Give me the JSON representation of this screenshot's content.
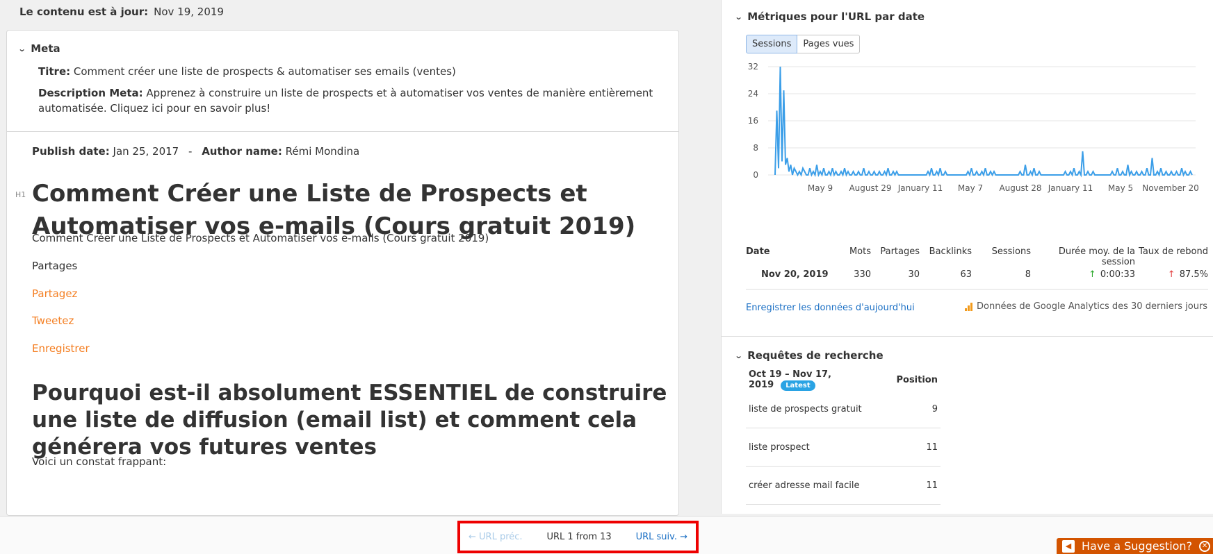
{
  "header": {
    "uptodate_label": "Le contenu est à jour:",
    "uptodate_date": "Nov 19, 2019"
  },
  "meta": {
    "title": "Meta",
    "titre_label": "Titre:",
    "titre_value": "Comment créer une liste de prospects & automatiser ses emails (ventes)",
    "desc_label": "Description Meta:",
    "desc_value": "Apprenez à construire un liste de prospects et à automatiser vos ventes de manière entièrement automatisée. Cliquez ici pour en savoir plus!"
  },
  "article": {
    "publish_label": "Publish date:",
    "publish_value": "Jan 25, 2017",
    "separator": "-",
    "author_label": "Author name:",
    "author_value": "Rémi Mondina",
    "h1_tag": "H1",
    "h1": "Comment Créer une Liste de Prospects et Automatiser vos e-mails (Cours gratuit 2019)",
    "p1": "Comment Créer une Liste de Prospects et Automatiser vos e-mails (Cours gratuit 2019)",
    "p2": "Partages",
    "links": [
      "Partagez",
      "Tweetez",
      "Enregistrer"
    ],
    "h2": "Pourquoi est-il absolument ESSENTIEL de construire une liste de diffusion (email list) et comment cela générera vos futures ventes",
    "p3": "Voici un constat frappant:"
  },
  "metrics": {
    "title": "Métriques pour l'URL par date",
    "tabs": [
      "Sessions",
      "Pages vues"
    ],
    "active_tab": "Sessions",
    "table": {
      "headers": [
        "Date",
        "Mots",
        "Partages",
        "Backlinks",
        "Sessions",
        "Durée moy. de la session",
        "Taux de rebond"
      ],
      "row": {
        "date": "Nov 20, 2019",
        "mots": "330",
        "partages": "30",
        "backlinks": "63",
        "sessions": "8",
        "duree": "0:00:33",
        "rebond": "87.5%"
      },
      "up_arrow": "↑"
    },
    "save_link": "Enregistrer les données d'aujourd'hui",
    "ga_note": "Données de Google Analytics des 30 derniers jours"
  },
  "chart_data": {
    "type": "line",
    "ylim": [
      0,
      32
    ],
    "yticks": [
      "0",
      "8",
      "16",
      "24",
      "32"
    ],
    "xticks": [
      "May 9",
      "August 29",
      "January 11",
      "May 7",
      "August 28",
      "January 11",
      "May 5",
      "November 20"
    ],
    "series": [
      {
        "values": [
          0,
          19,
          2,
          32,
          4,
          25,
          3,
          5,
          1,
          3,
          0,
          2,
          1,
          0,
          1,
          0,
          2,
          1,
          0,
          0,
          2,
          0,
          1,
          0,
          3,
          0,
          1,
          0,
          2,
          0,
          0,
          1,
          0,
          2,
          0,
          1,
          0,
          0,
          1,
          0,
          2,
          0,
          1,
          0,
          0,
          1,
          0,
          0,
          1,
          0,
          0,
          2,
          0,
          0,
          1,
          0,
          0,
          1,
          0,
          0,
          1,
          0,
          0,
          1,
          0,
          2,
          0,
          0,
          1,
          0,
          1,
          0,
          0,
          0,
          0,
          0,
          0,
          0,
          0,
          0,
          0,
          0,
          0,
          0,
          0,
          0,
          0,
          0,
          1,
          0,
          2,
          0,
          0,
          1,
          0,
          2,
          0,
          0,
          1,
          0,
          0,
          0,
          0,
          0,
          0,
          0,
          0,
          0,
          0,
          0,
          0,
          1,
          0,
          2,
          0,
          0,
          1,
          0,
          0,
          1,
          0,
          2,
          0,
          0,
          1,
          0,
          1,
          0,
          0,
          0,
          0,
          0,
          0,
          0,
          0,
          0,
          0,
          0,
          0,
          0,
          0,
          1,
          0,
          0,
          3,
          0,
          0,
          1,
          0,
          2,
          0,
          0,
          1,
          0,
          0,
          0,
          0,
          0,
          0,
          0,
          0,
          0,
          0,
          0,
          0,
          0,
          0,
          1,
          0,
          0,
          1,
          0,
          2,
          0,
          0,
          1,
          0,
          7,
          0,
          0,
          1,
          0,
          0,
          1,
          0,
          0,
          0,
          0,
          0,
          0,
          0,
          0,
          0,
          0,
          1,
          0,
          0,
          2,
          0,
          0,
          1,
          0,
          0,
          3,
          0,
          1,
          0,
          0,
          1,
          0,
          0,
          1,
          0,
          0,
          2,
          0,
          0,
          5,
          0,
          0,
          1,
          0,
          2,
          0,
          0,
          1,
          0,
          0,
          1,
          0,
          0,
          1,
          0,
          0,
          2,
          0,
          1,
          0,
          0,
          1,
          0
        ]
      }
    ]
  },
  "queries": {
    "title": "Requêtes de recherche",
    "range": "Oct 19 – Nov 17, 2019",
    "badge": "Latest",
    "position_label": "Position",
    "rows": [
      {
        "query": "liste de prospects gratuit",
        "position": "9"
      },
      {
        "query": "liste prospect",
        "position": "11"
      },
      {
        "query": "créer adresse mail facile",
        "position": "11"
      }
    ]
  },
  "nav": {
    "prev": "← URL préc.",
    "count": "URL 1 from 13",
    "next": "URL suiv. →"
  },
  "suggest": {
    "label": "Have a Suggestion?"
  }
}
